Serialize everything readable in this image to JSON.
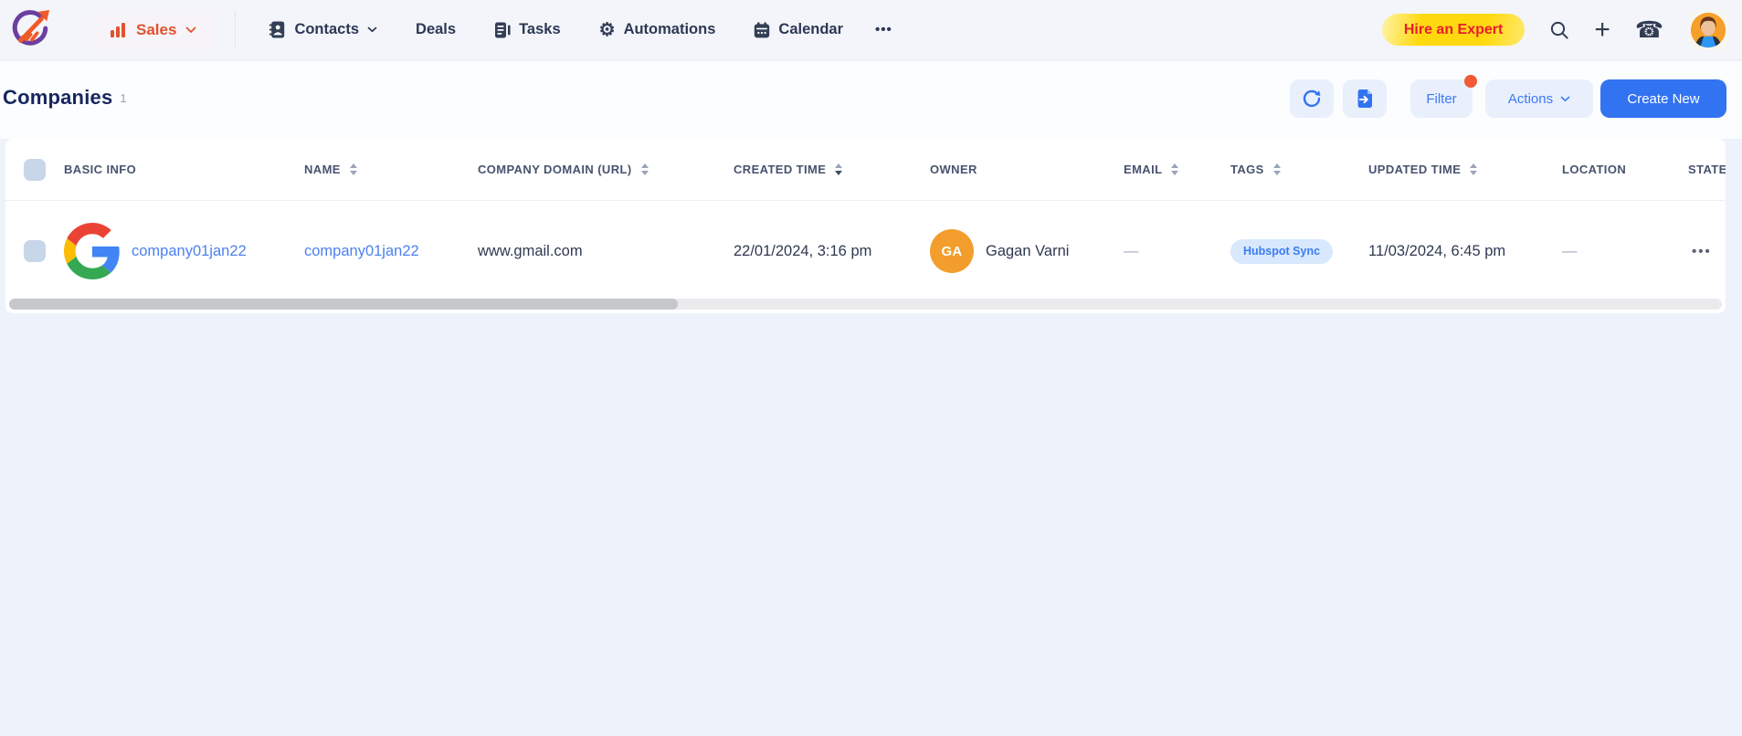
{
  "colors": {
    "accent_blue": "#3273f1",
    "brand_red": "#e2512e",
    "hire_expert_text": "#ea1c2d",
    "hire_expert_bg": "#ffd90f",
    "tag_bg": "#d8e8fd",
    "tag_text": "#3b7cf0",
    "owner_avatar_bg": "#f29d2c",
    "notification_dot": "#f05a35",
    "topnav_bg": "#f3f5fa",
    "page_bg": "#eef2fb"
  },
  "topnav": {
    "logo_icon": "salesmate-logo",
    "workspace": {
      "label": "Sales",
      "icon": "bar-chart-icon",
      "chevron": true
    },
    "items": [
      {
        "label": "Contacts",
        "icon": "contacts-book-icon",
        "chevron": true
      },
      {
        "label": "Deals",
        "icon": "",
        "chevron": false
      },
      {
        "label": "Tasks",
        "icon": "tasks-icon",
        "chevron": false
      },
      {
        "label": "Automations",
        "icon": "gear-icon",
        "chevron": false
      },
      {
        "label": "Calendar",
        "icon": "calendar-icon",
        "chevron": false
      }
    ],
    "glyphs": {
      "more": "•••",
      "gear": "⚙",
      "plus": "+",
      "phone": "☎"
    },
    "hire_expert": {
      "label": "Hire an Expert"
    },
    "right_icons": [
      "search-icon",
      "plus-icon",
      "phone-icon",
      "user-avatar"
    ]
  },
  "page": {
    "title": "Companies",
    "count": "1",
    "toolbar": {
      "refresh_icon": "refresh-icon",
      "export_icon": "export-icon",
      "filter": {
        "label": "Filter",
        "has_notification": true
      },
      "actions": {
        "label": "Actions",
        "chevron": true
      },
      "create_new": {
        "label": "Create New"
      }
    }
  },
  "table": {
    "select_all_checked": false,
    "columns": [
      {
        "label": "BASIC INFO",
        "sortable": false
      },
      {
        "label": "NAME",
        "sortable": true
      },
      {
        "label": "COMPANY DOMAIN (URL)",
        "sortable": true
      },
      {
        "label": "CREATED TIME",
        "sortable": true,
        "sorted": "desc"
      },
      {
        "label": "OWNER",
        "sortable": false
      },
      {
        "label": "EMAIL",
        "sortable": true
      },
      {
        "label": "TAGS",
        "sortable": true
      },
      {
        "label": "UPDATED TIME",
        "sortable": true
      },
      {
        "label": "LOCATION",
        "sortable": false
      },
      {
        "label": "STATE",
        "sortable": false
      }
    ],
    "rows": [
      {
        "selected": false,
        "logo_icon": "google-logo",
        "basic_info": "company01jan22",
        "name": "company01jan22",
        "company_domain_url": "www.gmail.com",
        "created_time": "22/01/2024, 3:16 pm",
        "owner": {
          "initials": "GA",
          "name": "Gagan Varni"
        },
        "email": "—",
        "tags": [
          {
            "label": "Hubspot Sync"
          }
        ],
        "updated_time": "11/03/2024, 6:45 pm",
        "location": "—",
        "state": "",
        "row_menu_glyph": "•••"
      }
    ],
    "hscrollbar": {
      "thumb_fraction": 0.39
    }
  }
}
